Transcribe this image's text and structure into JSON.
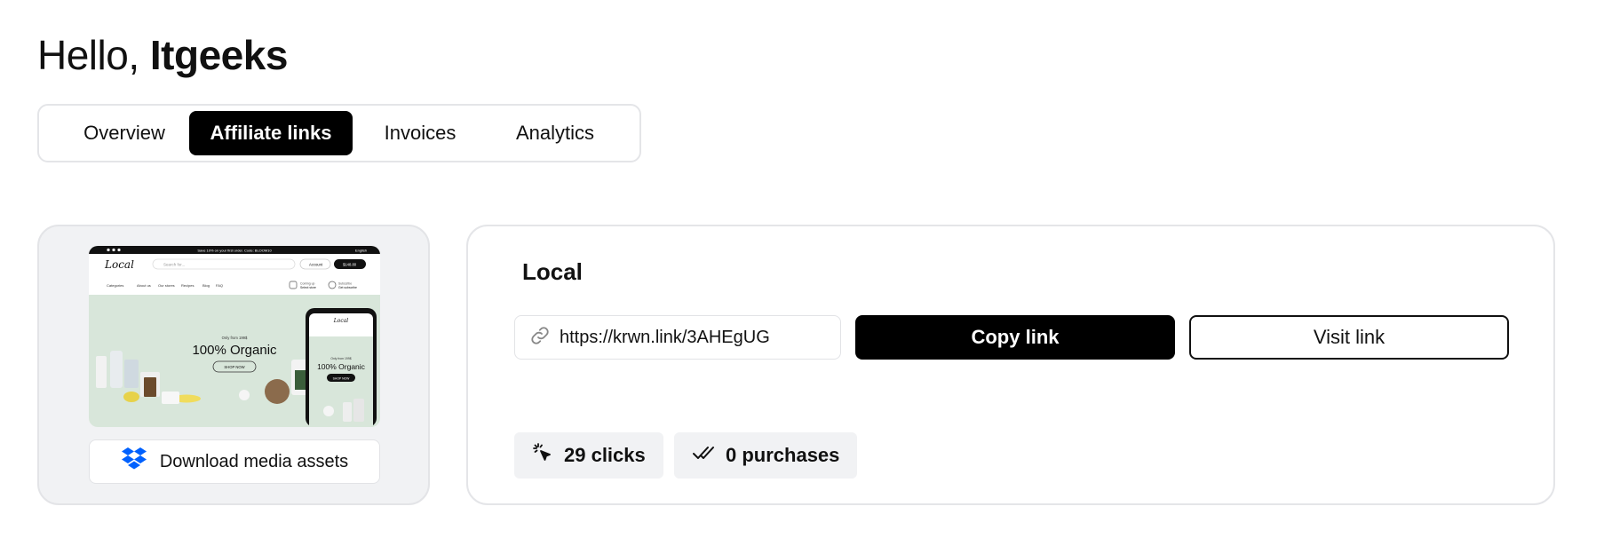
{
  "header": {
    "greeting_prefix": "Hello, ",
    "user_name": "Itgeeks"
  },
  "tabs": [
    {
      "label": "Overview",
      "active": false
    },
    {
      "label": "Affiliate links",
      "active": true
    },
    {
      "label": "Invoices",
      "active": false
    },
    {
      "label": "Analytics",
      "active": false
    }
  ],
  "media": {
    "download_label": "Download media assets",
    "download_icon": "dropbox-icon",
    "preview": {
      "announcement": "Save 10% on your first order. Code: BLOOM10",
      "language": "English",
      "logo": "Local",
      "search_placeholder": "Search for...",
      "account_label": "Account",
      "cart_label": "$148.80",
      "nav": [
        "Categories",
        "About us",
        "Our stores",
        "Recipes",
        "Blog",
        "FAQ"
      ],
      "delivery_line1": "Coming up",
      "delivery_line2": "Select store",
      "sub_line1": "Subscribe",
      "sub_line2": "Get subscribe",
      "promo_small": "Only from 199$",
      "promo_title": "100% Organic",
      "promo_button": "SHOP NOW",
      "phone_promo_small": "Only from 199$",
      "phone_promo_title": "100% Organic",
      "phone_button": "SHOP NOW"
    }
  },
  "link": {
    "brand": "Local",
    "url": "https://krwn.link/3AHEgUG",
    "copy_label": "Copy link",
    "visit_label": "Visit link"
  },
  "stats": {
    "clicks": "29 clicks",
    "purchases": "0 purchases"
  },
  "colors": {
    "accent": "#000000",
    "card_bg": "#f1f2f4",
    "border": "#e4e5e8",
    "dropbox": "#0061fe"
  }
}
